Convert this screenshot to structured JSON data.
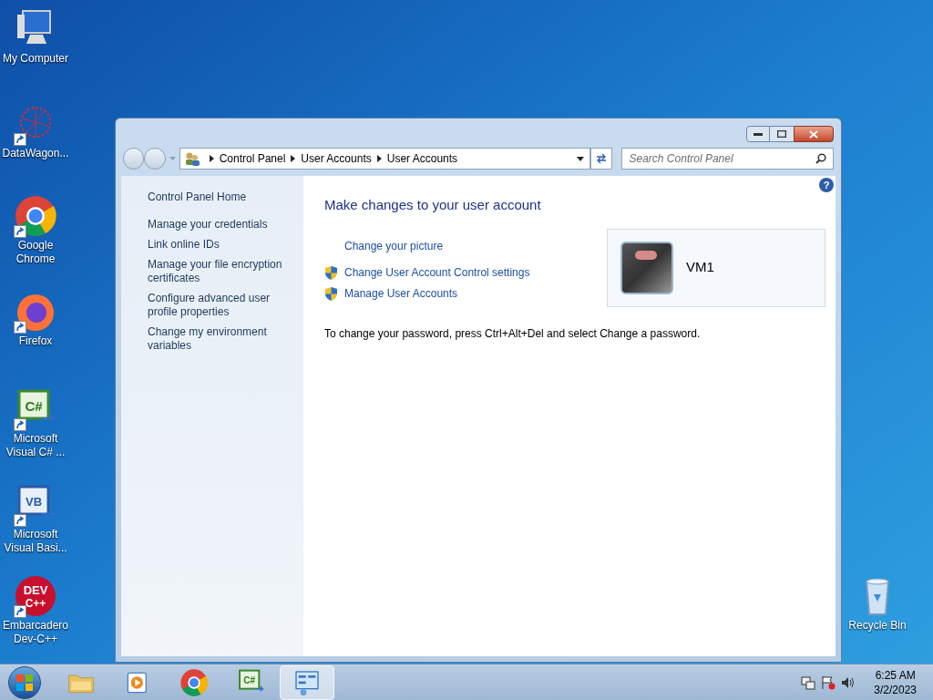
{
  "desktop_icons": [
    {
      "label": "My Computer",
      "kind": "computer",
      "shortcut": false
    },
    {
      "label": "DataWagon...",
      "kind": "network",
      "shortcut": true
    },
    {
      "label": "Google Chrome",
      "kind": "chrome",
      "shortcut": true
    },
    {
      "label": "Firefox",
      "kind": "firefox",
      "shortcut": true
    },
    {
      "label": "Microsoft Visual C# ...",
      "kind": "csharp",
      "shortcut": true,
      "glyph": "C#"
    },
    {
      "label": "Microsoft Visual Basi...",
      "kind": "vb",
      "shortcut": true,
      "glyph": "VB"
    },
    {
      "label": "Embarcadero Dev-C++",
      "kind": "dev",
      "shortcut": true,
      "glyph": "DEV",
      "glyph2": "C++"
    },
    {
      "label": "Recycle Bin",
      "kind": "bin",
      "shortcut": false
    }
  ],
  "window": {
    "help": "?",
    "breadcrumb": [
      "Control Panel",
      "User Accounts",
      "User Accounts"
    ],
    "search": {
      "placeholder": "Search Control Panel"
    },
    "sidebar": {
      "home": "Control Panel Home",
      "items": [
        "Manage your credentials",
        "Link online IDs",
        "Manage your file encryption certificates",
        "Configure advanced user profile properties",
        "Change my environment variables"
      ]
    },
    "heading": "Make changes to your user account",
    "tasks": [
      {
        "label": "Change your picture",
        "shield": false
      },
      {
        "label": "Change User Account Control settings",
        "shield": true
      },
      {
        "label": "Manage User Accounts",
        "shield": true
      }
    ],
    "account": {
      "name": "VM1"
    },
    "note": "To change your password, press Ctrl+Alt+Del and select Change a password."
  },
  "taskbar": {
    "items": [
      {
        "kind": "folder",
        "selected": false
      },
      {
        "kind": "media",
        "selected": false
      },
      {
        "kind": "chrome",
        "selected": false
      },
      {
        "kind": "csharp",
        "selected": false,
        "glyph": "C#"
      },
      {
        "kind": "panel",
        "selected": true
      }
    ],
    "time": "6:25 AM",
    "date": "3/2/2023"
  }
}
